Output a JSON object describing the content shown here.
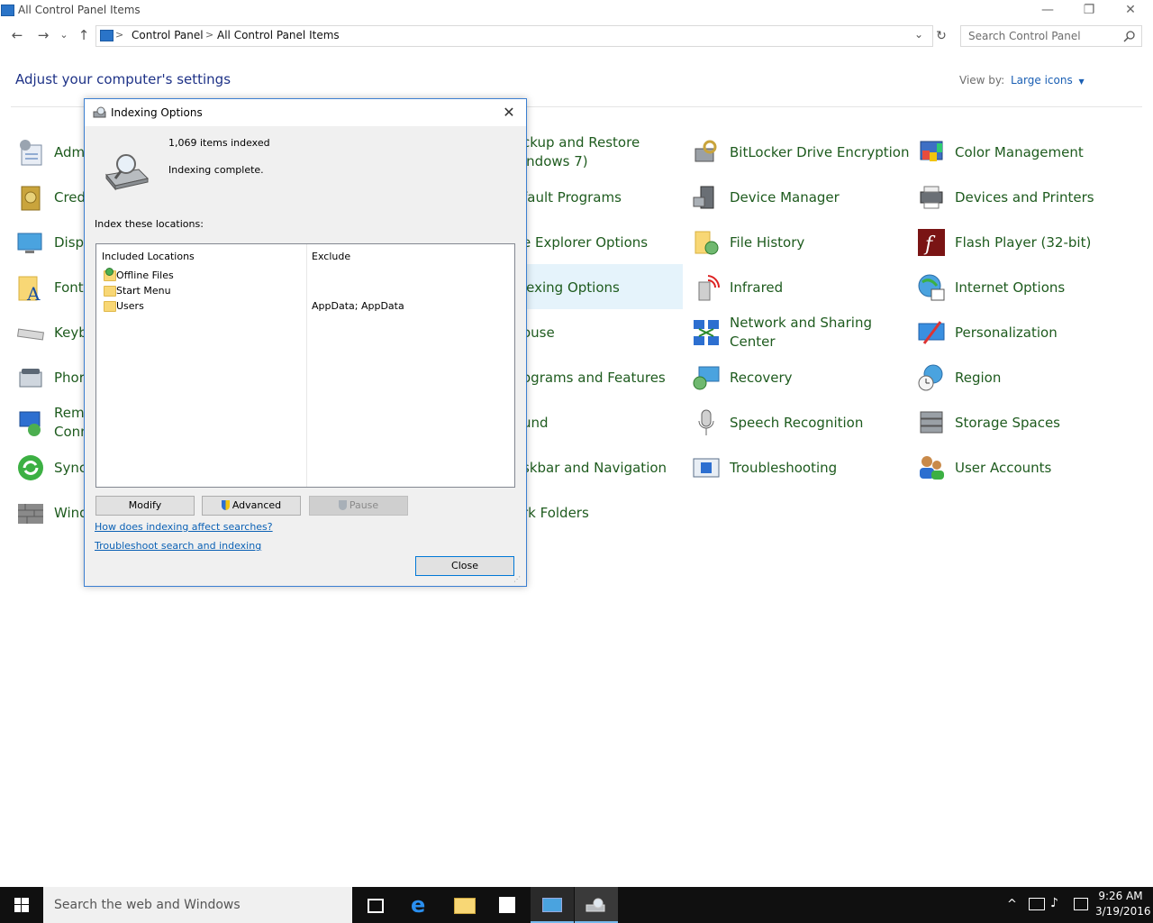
{
  "window": {
    "title": "All Control Panel Items",
    "minimize": "—",
    "restore": "❐",
    "close": "✕"
  },
  "nav": {
    "back": "←",
    "forward": "→",
    "recent": "⌄",
    "up": "↑",
    "breadcrumb": [
      "Control Panel",
      "All Control Panel Items"
    ],
    "separator": ">",
    "refresh": "↻",
    "dropdown": "⌄",
    "search_placeholder": "Search Control Panel"
  },
  "main": {
    "heading": "Adjust your computer's settings",
    "view_by_label": "View by:",
    "view_by_value": "Large icons",
    "items_col1": [
      "Adm",
      "Cred",
      "Disp",
      "Font",
      "Keyb",
      "Phor",
      "Rem\nConn",
      "Sync",
      "Wind"
    ],
    "items_col2": [
      "ckup and Restore\nindows 7)",
      "fault Programs",
      "e Explorer Options",
      "lexing Options",
      "ouse",
      "ograms and Features",
      "und",
      "skbar and Navigation",
      "rk Folders"
    ],
    "items_col3": [
      "BitLocker Drive Encryption",
      "Device Manager",
      "File History",
      "Infrared",
      "Network and Sharing\nCenter",
      "Recovery",
      "Speech Recognition",
      "Troubleshooting"
    ],
    "items_col4": [
      "Color Management",
      "Devices and Printers",
      "Flash Player (32-bit)",
      "Internet Options",
      "Personalization",
      "Region",
      "Storage Spaces",
      "User Accounts"
    ]
  },
  "dialog": {
    "title": "Indexing Options",
    "items_indexed": "1,069 items indexed",
    "status": "Indexing complete.",
    "index_label": "Index these locations:",
    "col_included": "Included Locations",
    "col_exclude": "Exclude",
    "locations": [
      {
        "name": "Offline Files",
        "exclude": ""
      },
      {
        "name": "Start Menu",
        "exclude": ""
      },
      {
        "name": "Users",
        "exclude": "AppData; AppData"
      }
    ],
    "modify": "Modify",
    "advanced": "Advanced",
    "pause": "Pause",
    "link1": "How does indexing affect searches?",
    "link2": "Troubleshoot search and indexing",
    "close": "Close"
  },
  "taskbar": {
    "search_placeholder": "Search the web and Windows",
    "time": "9:26 AM",
    "date": "3/19/2016"
  }
}
